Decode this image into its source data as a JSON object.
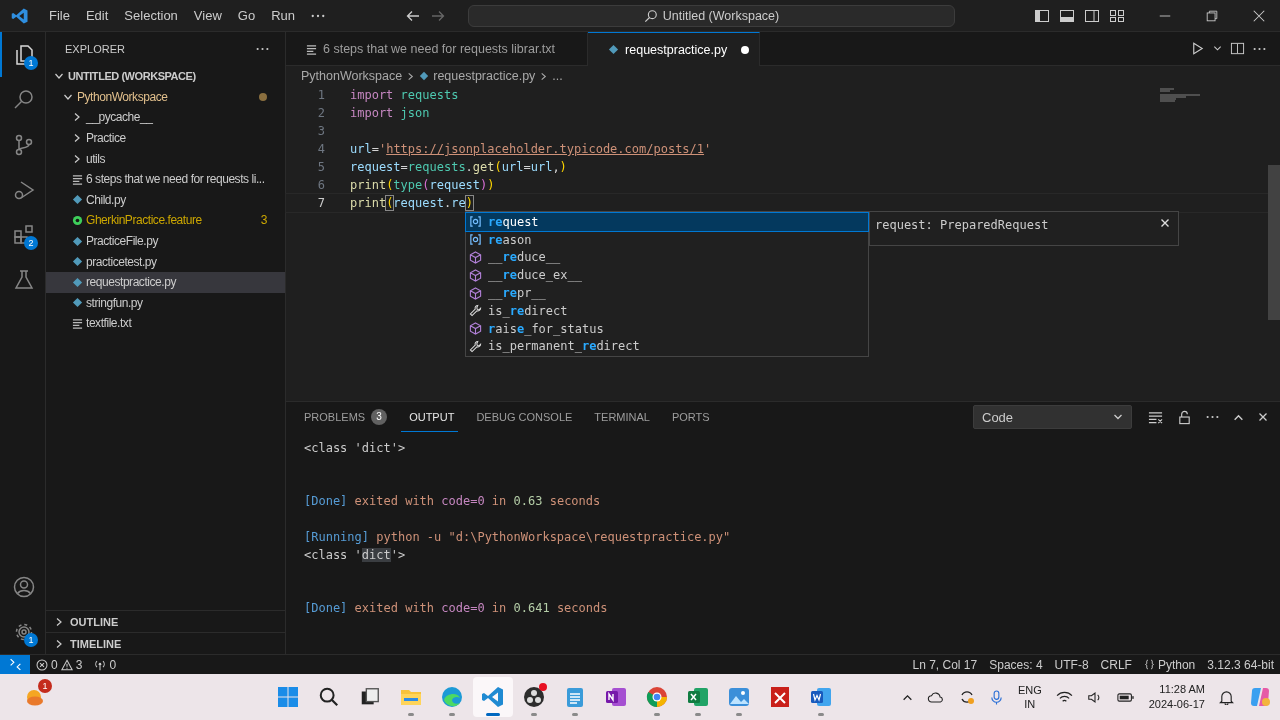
{
  "title_bar": {
    "menu": [
      "File",
      "Edit",
      "Selection",
      "View",
      "Go",
      "Run"
    ],
    "command_center": "Untitled (Workspace)"
  },
  "activity_bar": {
    "items": [
      {
        "kind": "explorer",
        "selected": true,
        "badge": "1"
      },
      {
        "kind": "search",
        "selected": false
      },
      {
        "kind": "source-control",
        "selected": false
      },
      {
        "kind": "run",
        "selected": false
      },
      {
        "kind": "extensions",
        "selected": false,
        "badge": "2"
      },
      {
        "kind": "testing",
        "selected": false
      }
    ],
    "bottom": [
      {
        "kind": "account"
      },
      {
        "kind": "settings",
        "badge": "1"
      }
    ]
  },
  "sidebar": {
    "title": "EXPLORER",
    "tree": [
      {
        "label": "UNTITLED (WORKSPACE)",
        "kind": "root",
        "expanded": true,
        "selected": false,
        "children": [
          {
            "label": "PythonWorkspace",
            "kind": "folder",
            "expanded": true,
            "selected": false,
            "modified": true,
            "children": [
              {
                "label": "__pycache__",
                "kind": "folder",
                "expanded": false,
                "selected": false
              },
              {
                "label": "Practice",
                "kind": "folder",
                "expanded": false,
                "selected": false
              },
              {
                "label": "utils",
                "kind": "folder",
                "expanded": false,
                "selected": false
              },
              {
                "label": "6 steps that we need for requests li...",
                "kind": "text",
                "selected": false
              },
              {
                "label": "Child.py",
                "kind": "python",
                "selected": false
              },
              {
                "label": "GherkinPractice.feature",
                "kind": "feature",
                "selected": false,
                "warning": true,
                "badge": "3"
              },
              {
                "label": "PracticeFile.py",
                "kind": "python",
                "selected": false
              },
              {
                "label": "practicetest.py",
                "kind": "python",
                "selected": false
              },
              {
                "label": "requestpractice.py",
                "kind": "python",
                "selected": true
              },
              {
                "label": "stringfun.py",
                "kind": "python",
                "selected": false
              },
              {
                "label": "textfile.txt",
                "kind": "text",
                "selected": false
              }
            ]
          }
        ]
      }
    ],
    "sections": [
      {
        "label": "OUTLINE",
        "expanded": false
      },
      {
        "label": "TIMELINE",
        "expanded": false
      }
    ]
  },
  "tabs": [
    {
      "label": "6 steps that we need for requests librar.txt",
      "kind": "text",
      "selected": false,
      "dirty": false
    },
    {
      "label": "requestpractice.py",
      "kind": "python",
      "selected": true,
      "dirty": true
    }
  ],
  "breadcrumb": [
    {
      "label": "PythonWorkspace",
      "kind": "folder"
    },
    {
      "label": "requestpractice.py",
      "kind": "python"
    },
    {
      "label": "...",
      "kind": "symbol"
    }
  ],
  "code": [
    {
      "number": "1",
      "active": false,
      "tokens": [
        {
          "text": "import",
          "kind": "keyword"
        },
        {
          "text": " requests",
          "kind": "module"
        }
      ]
    },
    {
      "number": "2",
      "active": false,
      "tokens": [
        {
          "text": "import",
          "kind": "keyword"
        },
        {
          "text": " json",
          "kind": "module"
        }
      ]
    },
    {
      "number": "3",
      "active": false
    },
    {
      "number": "4",
      "active": false,
      "tokens": [
        {
          "text": "url",
          "kind": "var"
        },
        {
          "text": "=",
          "kind": "op"
        },
        {
          "text": "'",
          "kind": "string"
        },
        {
          "text": "https://jsonplaceholder.typicode.com/posts/1",
          "kind": "link"
        },
        {
          "text": "'",
          "kind": "string"
        }
      ]
    },
    {
      "number": "5",
      "active": false,
      "tokens": [
        {
          "text": "request",
          "kind": "var"
        },
        {
          "text": "=",
          "kind": "op"
        },
        {
          "text": "requests",
          "kind": "module"
        },
        {
          "text": ".",
          "kind": "op"
        },
        {
          "text": "get",
          "kind": "func"
        },
        {
          "text": "(",
          "kind": "bracket1"
        },
        {
          "text": "url",
          "kind": "var"
        },
        {
          "text": "=",
          "kind": "op"
        },
        {
          "text": "url",
          "kind": "var"
        },
        {
          "text": ",",
          "kind": "op"
        },
        {
          "text": ")",
          "kind": "bracket1"
        }
      ]
    },
    {
      "number": "6",
      "active": false,
      "tokens": [
        {
          "text": "print",
          "kind": "func"
        },
        {
          "text": "(",
          "kind": "bracket1"
        },
        {
          "text": "type",
          "kind": "type"
        },
        {
          "text": "(",
          "kind": "bracket2"
        },
        {
          "text": "request",
          "kind": "var"
        },
        {
          "text": ")",
          "kind": "bracket2"
        },
        {
          "text": ")",
          "kind": "bracket1"
        }
      ]
    },
    {
      "number": "7",
      "active": true,
      "tokens": [
        {
          "text": "print",
          "kind": "func"
        },
        {
          "text": "(",
          "kind": "match"
        },
        {
          "text": "request",
          "kind": "var"
        },
        {
          "text": ".",
          "kind": "op"
        },
        {
          "text": "re",
          "kind": "var"
        },
        {
          "text": ")",
          "kind": "match"
        }
      ]
    }
  ],
  "suggest": {
    "items": [
      {
        "kind": "field",
        "selected": true,
        "label": "**re**quest"
      },
      {
        "kind": "field",
        "selected": false,
        "label": "**re**ason"
      },
      {
        "kind": "method",
        "selected": false,
        "label": "__**re**duce__"
      },
      {
        "kind": "method",
        "selected": false,
        "label": "__**re**duce_ex__"
      },
      {
        "kind": "method",
        "selected": false,
        "label": "__**re**pr__"
      },
      {
        "kind": "property",
        "selected": false,
        "label": "is_**re**direct"
      },
      {
        "kind": "method",
        "selected": false,
        "label": "**r**ais**e**_for_status"
      },
      {
        "kind": "property",
        "selected": false,
        "label": "is_permanent_**re**direct"
      }
    ],
    "detail": "request: PreparedRequest"
  },
  "panel": {
    "tabs": [
      {
        "label": "PROBLEMS",
        "selected": false,
        "badge": "3"
      },
      {
        "label": "OUTPUT",
        "selected": true
      },
      {
        "label": "DEBUG CONSOLE",
        "selected": false
      },
      {
        "label": "TERMINAL",
        "selected": false
      },
      {
        "label": "PORTS",
        "selected": false
      }
    ],
    "channel": "Code",
    "output": [
      {
        "kind": "text",
        "tokens": [
          {
            "text": "<class '",
            "kind": "plain"
          },
          {
            "text": "dict",
            "kind": "plain"
          },
          {
            "text": "'>",
            "kind": "plain"
          }
        ]
      },
      {
        "kind": "blank"
      },
      {
        "kind": "blank"
      },
      {
        "kind": "text",
        "tokens": [
          {
            "text": "[Done]",
            "kind": "tag"
          },
          {
            "text": " exited with ",
            "kind": "msg"
          },
          {
            "text": "code=0",
            "kind": "code"
          },
          {
            "text": " in ",
            "kind": "msg"
          },
          {
            "text": "0.63",
            "kind": "num"
          },
          {
            "text": " seconds",
            "kind": "msg"
          }
        ]
      },
      {
        "kind": "blank"
      },
      {
        "kind": "text",
        "tokens": [
          {
            "text": "[Running]",
            "kind": "tag"
          },
          {
            "text": " python -u \"d:\\PythonWorkspace\\requestpractice.py\"",
            "kind": "msg"
          }
        ]
      },
      {
        "kind": "text",
        "tokens": [
          {
            "text": "<class '",
            "kind": "plain"
          },
          {
            "text": "dict",
            "kind": "highlight"
          },
          {
            "text": "'>",
            "kind": "plain"
          }
        ]
      },
      {
        "kind": "blank"
      },
      {
        "kind": "blank"
      },
      {
        "kind": "text",
        "tokens": [
          {
            "text": "[Done]",
            "kind": "tag"
          },
          {
            "text": " exited with ",
            "kind": "msg"
          },
          {
            "text": "code=0",
            "kind": "code"
          },
          {
            "text": " in ",
            "kind": "msg"
          },
          {
            "text": "0.641",
            "kind": "num"
          },
          {
            "text": " seconds",
            "kind": "msg"
          }
        ]
      }
    ]
  },
  "status_bar": {
    "errors": "0",
    "warnings": "3",
    "ports": "0",
    "right": [
      {
        "text": "Ln 7, Col 17",
        "kind": "plain"
      },
      {
        "text": "Spaces: 4",
        "kind": "plain"
      },
      {
        "text": "UTF-8",
        "kind": "plain"
      },
      {
        "text": "CRLF",
        "kind": "plain"
      },
      {
        "text": "Python",
        "kind": "language"
      },
      {
        "text": "3.12.3 64-bit",
        "kind": "plain"
      }
    ]
  },
  "taskbar": {
    "widget_badge": "1",
    "apps": [
      {
        "kind": "start",
        "running": false,
        "active": false
      },
      {
        "kind": "search",
        "running": false,
        "active": false
      },
      {
        "kind": "taskview",
        "running": false,
        "active": false
      },
      {
        "kind": "files",
        "running": true,
        "active": false
      },
      {
        "kind": "browser",
        "running": true,
        "active": false
      },
      {
        "kind": "editor",
        "running": true,
        "active": true
      },
      {
        "kind": "recorder",
        "running": true,
        "active": false,
        "alert": true
      },
      {
        "kind": "notepad",
        "running": true,
        "active": false
      },
      {
        "kind": "notes",
        "running": false,
        "active": false
      },
      {
        "kind": "chrome",
        "running": true,
        "active": false
      },
      {
        "kind": "sheet",
        "running": true,
        "active": false
      },
      {
        "kind": "photos",
        "running": true,
        "active": false
      },
      {
        "kind": "pdf",
        "running": false,
        "active": false
      },
      {
        "kind": "doc",
        "running": true,
        "active": false
      }
    ],
    "language": [
      "ENG",
      "IN"
    ],
    "time": "11:28 AM",
    "date": "2024-06-17"
  }
}
